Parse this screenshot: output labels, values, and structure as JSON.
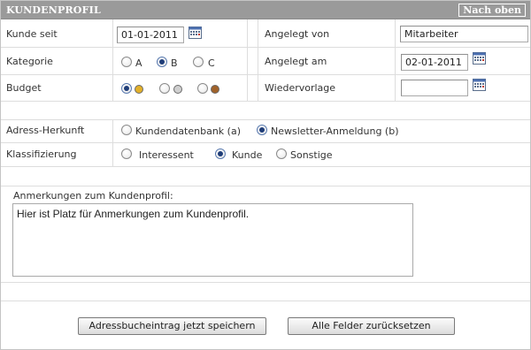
{
  "header": {
    "title": "KUNDENPROFIL",
    "top_link": "Nach oben"
  },
  "rows": {
    "kunde_seit": {
      "label": "Kunde seit",
      "value": "01-01-2011"
    },
    "angelegt_von": {
      "label": "Angelegt von",
      "value": "Mitarbeiter"
    },
    "kategorie": {
      "label": "Kategorie",
      "options": [
        "A",
        "B",
        "C"
      ],
      "selected": "B"
    },
    "angelegt_am": {
      "label": "Angelegt am",
      "value": "02-01-2011"
    },
    "budget": {
      "label": "Budget",
      "selected_index": 0,
      "colors": [
        "#e2b02a",
        "#cfcfcf",
        "#a0622a"
      ]
    },
    "wiedervorlage": {
      "label": "Wiedervorlage",
      "value": ""
    },
    "adress_herkunft": {
      "label": "Adress-Herkunft",
      "options": [
        "Kundendatenbank (a)",
        "Newsletter-Anmeldung (b)"
      ],
      "selected": "Newsletter-Anmeldung (b)"
    },
    "klassifizierung": {
      "label": "Klassifizierung",
      "options": [
        "Interessent",
        "Kunde",
        "Sonstige"
      ],
      "selected": "Kunde"
    }
  },
  "remarks": {
    "label": "Anmerkungen zum Kundenprofil:",
    "value": "Hier ist Platz für Anmerkungen zum Kundenprofil."
  },
  "buttons": {
    "save": "Adressbucheintrag jetzt speichern",
    "reset": "Alle Felder zurücksetzen"
  },
  "icons": {
    "calendar": "calendar-icon"
  }
}
